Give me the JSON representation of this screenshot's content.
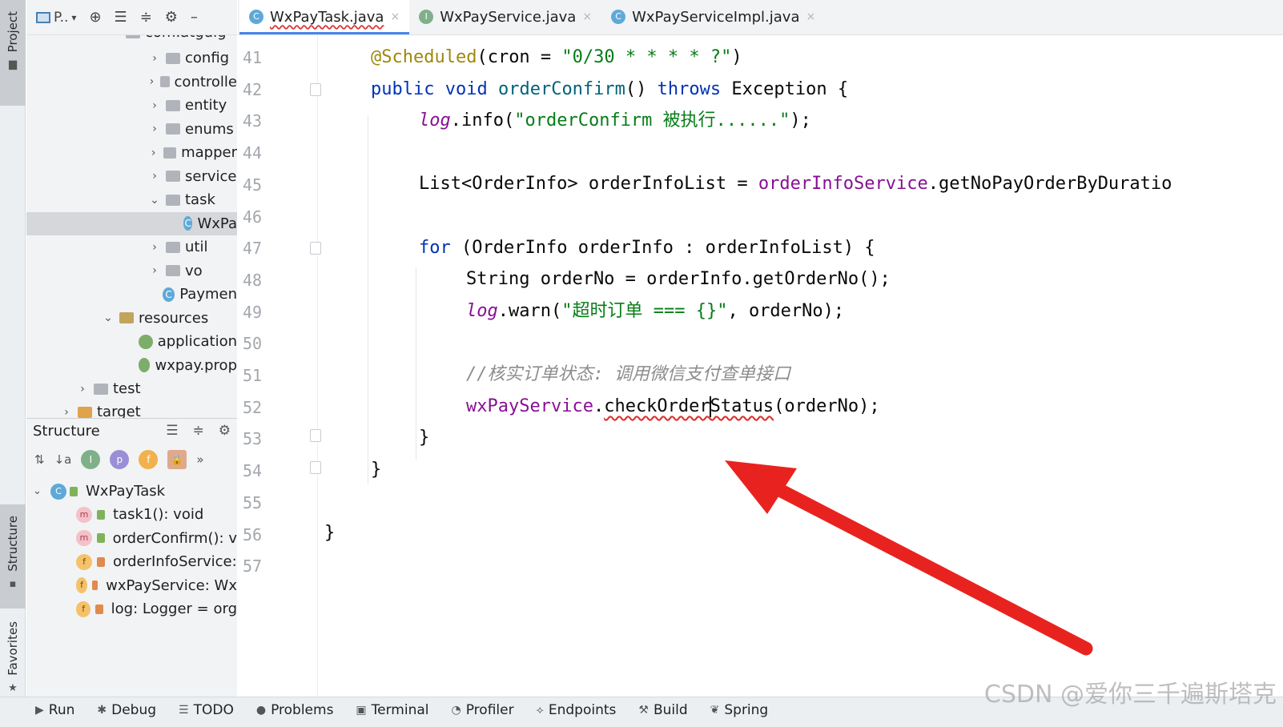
{
  "left_strip": {
    "project_label": "Project",
    "structure_label": "Structure",
    "favorites_label": "Favorites"
  },
  "project_panel": {
    "title": "P..",
    "top_cut_label": "com.atguig",
    "tree": [
      {
        "label": "config",
        "type": "folder"
      },
      {
        "label": "controlle",
        "type": "folder"
      },
      {
        "label": "entity",
        "type": "folder"
      },
      {
        "label": "enums",
        "type": "folder"
      },
      {
        "label": "mapper",
        "type": "folder"
      },
      {
        "label": "service",
        "type": "folder"
      },
      {
        "label": "task",
        "type": "folder-open"
      },
      {
        "label": "WxPa",
        "type": "class",
        "selected": true
      },
      {
        "label": "util",
        "type": "folder"
      },
      {
        "label": "vo",
        "type": "folder"
      },
      {
        "label": "Paymen",
        "type": "class-main"
      },
      {
        "label": "resources",
        "type": "resources"
      },
      {
        "label": "application",
        "type": "config"
      },
      {
        "label": "wxpay.prop",
        "type": "config"
      },
      {
        "label": "test",
        "type": "folder"
      },
      {
        "label": "target",
        "type": "target"
      }
    ]
  },
  "structure_panel": {
    "title": "Structure",
    "root": "WxPayTask",
    "members": [
      {
        "kind": "m",
        "access": "pub",
        "label": "task1(): void"
      },
      {
        "kind": "m",
        "access": "pub",
        "label": "orderConfirm(): v"
      },
      {
        "kind": "f",
        "access": "priv",
        "label": "orderInfoService:"
      },
      {
        "kind": "f",
        "access": "priv",
        "label": "wxPayService: Wx"
      },
      {
        "kind": "f",
        "access": "priv",
        "label": "log: Logger = org"
      }
    ]
  },
  "tabs": [
    {
      "label": "WxPayTask.java",
      "icon": "C",
      "color": "#5fa9d8",
      "active": true
    },
    {
      "label": "WxPayService.java",
      "icon": "I",
      "color": "#7fb08a",
      "active": false
    },
    {
      "label": "WxPayServiceImpl.java",
      "icon": "C",
      "color": "#5fa9d8",
      "active": false
    }
  ],
  "editor": {
    "line_numbers": [
      "41",
      "42",
      "43",
      "44",
      "45",
      "46",
      "47",
      "48",
      "49",
      "50",
      "51",
      "52",
      "53",
      "54",
      "55",
      "56",
      "57"
    ],
    "code": {
      "l41_ann": "@Scheduled",
      "l41_rest_a": "(cron = ",
      "l41_str": "\"0/30 * * * * ?\"",
      "l41_rest_b": ")",
      "l42_kw1": "public",
      "l42_kw2": "void",
      "l42_mth": "orderConfirm",
      "l42_paren": "() ",
      "l42_kw3": "throws",
      "l42_rest": " Exception {",
      "l43_fld": "log",
      "l43_rest_a": ".info(",
      "l43_str": "\"orderConfirm 被执行......\"",
      "l43_rest_b": ");",
      "l45_a": "List<OrderInfo> orderInfoList = ",
      "l45_fld": "orderInfoService",
      "l45_b": ".getNoPayOrderByDuratio",
      "l47_kw": "for",
      "l47_rest": " (OrderInfo orderInfo : orderInfoList) {",
      "l48": "String orderNo = orderInfo.getOrderNo();",
      "l49_fld": "log",
      "l49_rest_a": ".warn(",
      "l49_str": "\"超时订单 === {}\"",
      "l49_rest_b": ", orderNo);",
      "l51_cmt": "//核实订单状态: 调用微信支付查单接口",
      "l52_fld": "wxPayService",
      "l52_dot": ".",
      "l52_m1": "checkOrder",
      "l52_m2": "Status",
      "l52_rest": "(orderNo);",
      "l53": "}",
      "l54": "}",
      "l56": "}"
    }
  },
  "bottom_bar": [
    {
      "label": "Run",
      "icon": "run-icon"
    },
    {
      "label": "Debug",
      "icon": "debug-icon"
    },
    {
      "label": "TODO",
      "icon": "todo-icon"
    },
    {
      "label": "Problems",
      "icon": "problems-icon"
    },
    {
      "label": "Terminal",
      "icon": "terminal-icon"
    },
    {
      "label": "Profiler",
      "icon": "profiler-icon"
    },
    {
      "label": "Endpoints",
      "icon": "endpoints-icon"
    },
    {
      "label": "Build",
      "icon": "build-icon"
    },
    {
      "label": "Spring",
      "icon": "spring-icon"
    }
  ],
  "watermark": "CSDN @爱你三千遍斯塔克",
  "colors": {
    "keyword": "#0033b3",
    "annotation": "#9e880d",
    "string": "#067d17",
    "field": "#871094",
    "method": "#00627a",
    "comment": "#8c8c8c",
    "arrow": "#e8231f",
    "active_tab_underline": "#4a86e8"
  }
}
